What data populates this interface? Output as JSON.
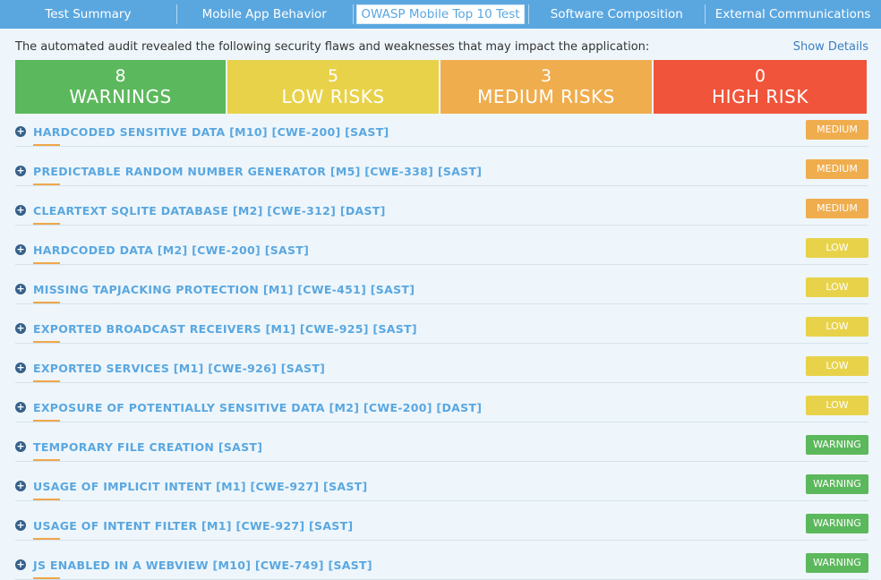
{
  "tabs": [
    {
      "label": "Test Summary",
      "active": false
    },
    {
      "label": "Mobile App Behavior",
      "active": false
    },
    {
      "label": "OWASP Mobile Top 10 Test",
      "active": true
    },
    {
      "label": "Software Composition",
      "active": false
    },
    {
      "label": "External Communications",
      "active": false
    }
  ],
  "intro": {
    "text": "The automated audit revealed the following security flaws and weaknesses that may impact the application:",
    "show_details": "Show Details"
  },
  "summary": [
    {
      "count": "8",
      "label": "WARNINGS",
      "color": "#5cb85c"
    },
    {
      "count": "5",
      "label": "LOW RISKS",
      "color": "#e8d24a"
    },
    {
      "count": "3",
      "label": "MEDIUM RISKS",
      "color": "#f0ad4e"
    },
    {
      "count": "0",
      "label": "HIGH RISK",
      "color": "#f0543a"
    }
  ],
  "severity_colors": {
    "MEDIUM": "#f0ad4e",
    "LOW": "#e8d24a",
    "WARNING": "#5cb85c"
  },
  "findings": [
    {
      "title": "HARDCODED SENSITIVE DATA [M10] [CWE-200] [SAST]",
      "severity": "MEDIUM"
    },
    {
      "title": "PREDICTABLE RANDOM NUMBER GENERATOR [M5] [CWE-338] [SAST]",
      "severity": "MEDIUM"
    },
    {
      "title": "CLEARTEXT SQLITE DATABASE [M2] [CWE-312] [DAST]",
      "severity": "MEDIUM"
    },
    {
      "title": "HARDCODED DATA [M2] [CWE-200] [SAST]",
      "severity": "LOW"
    },
    {
      "title": "MISSING TAPJACKING PROTECTION [M1] [CWE-451] [SAST]",
      "severity": "LOW"
    },
    {
      "title": "EXPORTED BROADCAST RECEIVERS [M1] [CWE-925] [SAST]",
      "severity": "LOW"
    },
    {
      "title": "EXPORTED SERVICES [M1] [CWE-926] [SAST]",
      "severity": "LOW"
    },
    {
      "title": "EXPOSURE OF POTENTIALLY SENSITIVE DATA [M2] [CWE-200] [DAST]",
      "severity": "LOW"
    },
    {
      "title": "TEMPORARY FILE CREATION [SAST]",
      "severity": "WARNING"
    },
    {
      "title": "USAGE OF IMPLICIT INTENT [M1] [CWE-927] [SAST]",
      "severity": "WARNING"
    },
    {
      "title": "USAGE OF INTENT FILTER [M1] [CWE-927] [SAST]",
      "severity": "WARNING"
    },
    {
      "title": "JS ENABLED IN A WEBVIEW [M10] [CWE-749] [SAST]",
      "severity": "WARNING"
    }
  ]
}
